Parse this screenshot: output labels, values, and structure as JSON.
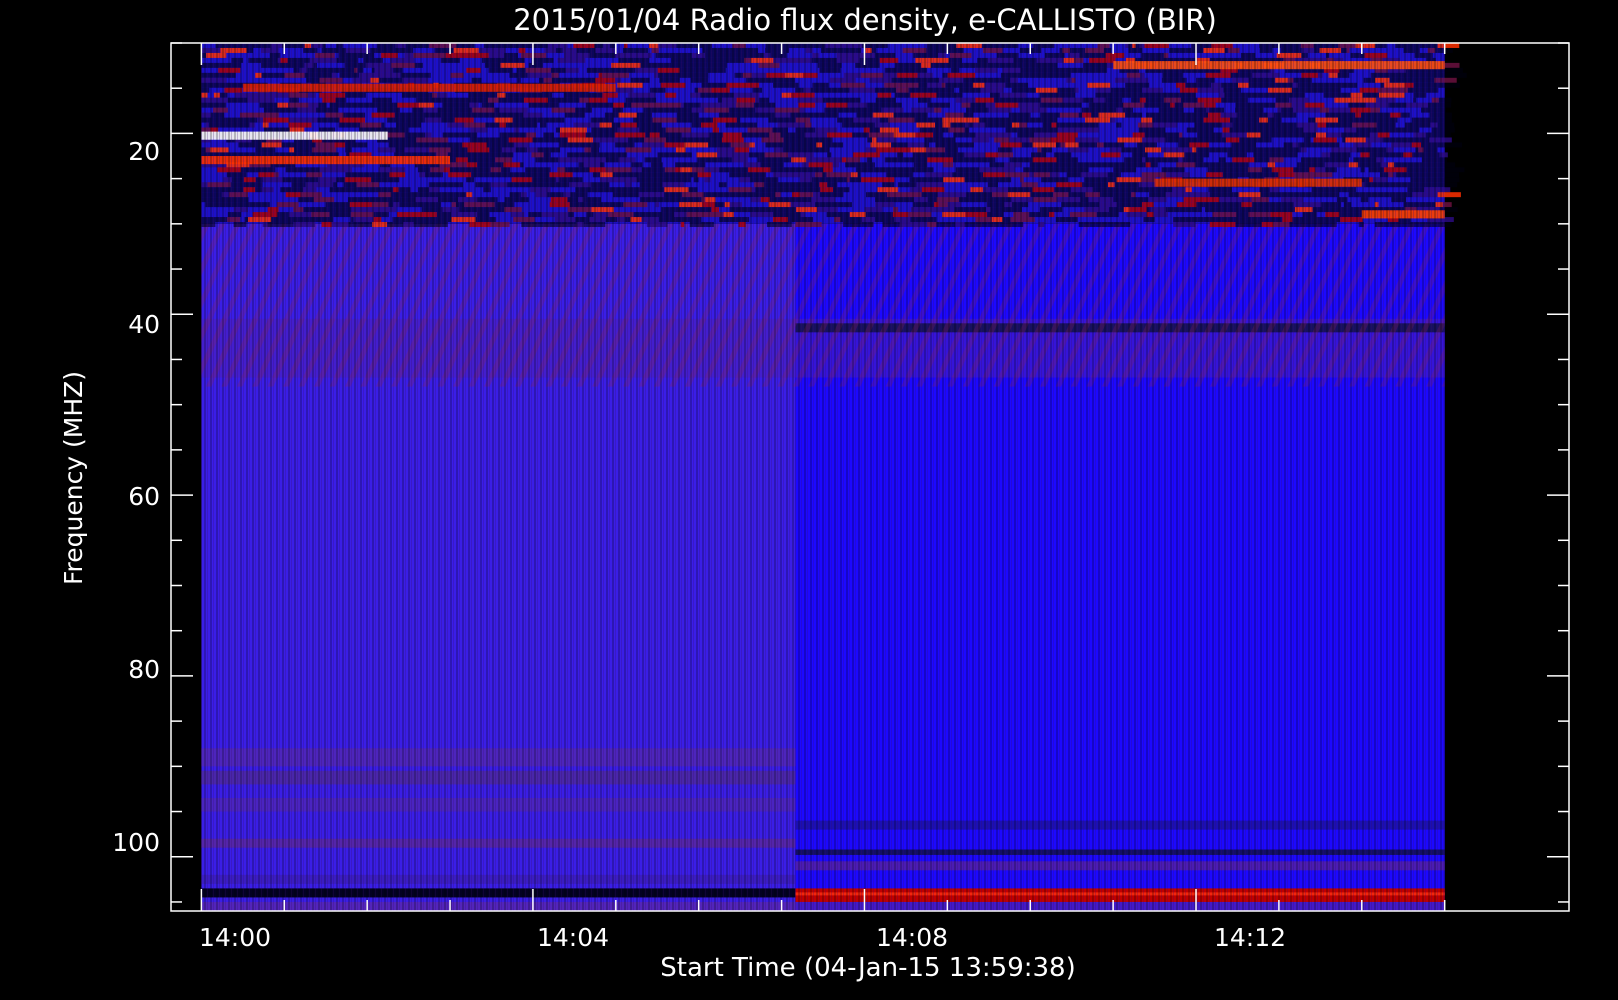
{
  "chart_data": {
    "type": "heatmap",
    "title": "2015/01/04  Radio flux density, e-CALLISTO (BIR)",
    "xlabel": "Start Time (04-Jan-15 13:59:38)",
    "ylabel": "Frequency (MHZ)",
    "x_ticks": [
      "14:00",
      "14:04",
      "14:08",
      "14:12"
    ],
    "y_ticks": [
      20,
      40,
      60,
      80,
      100
    ],
    "xlim": [
      "13:59:38",
      "14:16:30"
    ],
    "ylim": [
      106,
      10
    ],
    "data_time_range": [
      "14:00",
      "14:15"
    ],
    "data_freq_range_mhz": [
      10,
      106
    ],
    "colormap": [
      "#000000",
      "#1a00ff",
      "#5a1ea0",
      "#c00000",
      "#ff4000",
      "#ffffff"
    ],
    "features": [
      {
        "freq_mhz": [
          10,
          30
        ],
        "time": [
          "14:00",
          "14:15"
        ],
        "level": "high, intermittent"
      },
      {
        "freq_mhz": [
          30,
          106
        ],
        "time": [
          "14:00",
          "14:07:10"
        ],
        "level": "moderate"
      },
      {
        "freq_mhz": [
          30,
          106
        ],
        "time": [
          "14:07:10",
          "14:15"
        ],
        "level": "low"
      },
      {
        "freq_mhz": [
          103.5,
          105
        ],
        "time": [
          "14:07:10",
          "14:15"
        ],
        "level": "high"
      }
    ]
  }
}
